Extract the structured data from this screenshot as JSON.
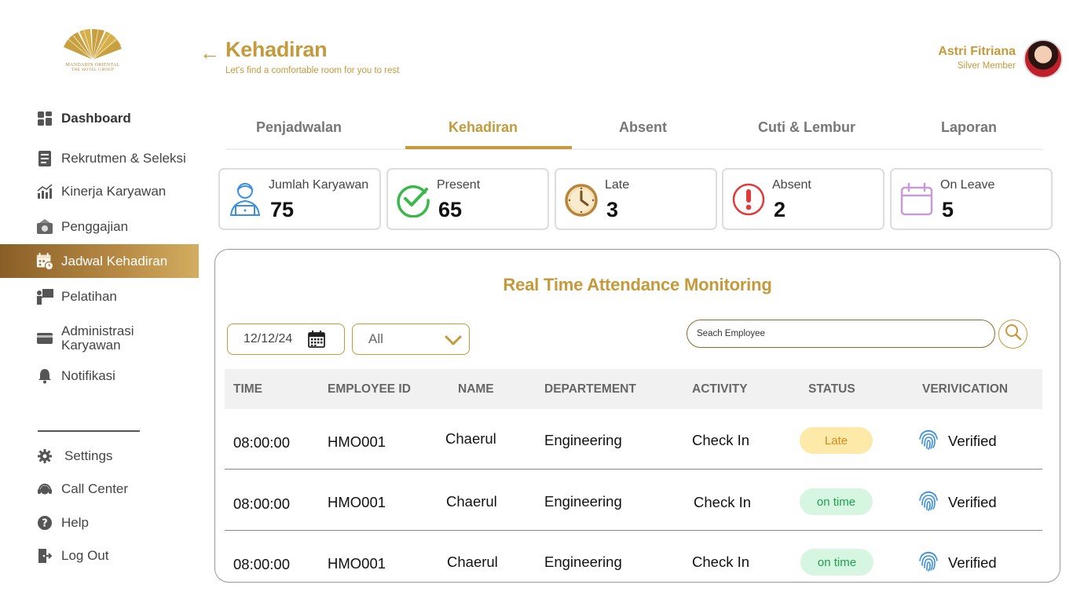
{
  "brand": {
    "line1": "MANDARIN ORIENTAL",
    "line2": "THE HOTEL GROUP"
  },
  "sidebar": {
    "items": [
      {
        "label": "Dashboard"
      },
      {
        "label": "Rekrutmen & Seleksi"
      },
      {
        "label": "Kinerja Karyawan"
      },
      {
        "label": "Penggajian"
      },
      {
        "label": "Jadwal Kehadiran"
      },
      {
        "label": "Pelatihan"
      },
      {
        "label": "Administrasi",
        "label2": "Karyawan"
      },
      {
        "label": "Notifikasi"
      }
    ],
    "bottom": [
      {
        "label": "Settings"
      },
      {
        "label": "Call Center"
      },
      {
        "label": "Help"
      },
      {
        "label": "Log Out"
      }
    ]
  },
  "header": {
    "title": "Kehadiran",
    "subtitle": "Let's find a comfortable room for you to rest",
    "back": "←"
  },
  "user": {
    "name": "Astri Fitriana",
    "tier": "Silver Member"
  },
  "tabs": [
    {
      "label": "Penjadwalan"
    },
    {
      "label": "Kehadiran"
    },
    {
      "label": "Absent"
    },
    {
      "label": "Cuti & Lembur"
    },
    {
      "label": "Laporan"
    }
  ],
  "stats": [
    {
      "label": "Jumlah Karyawan",
      "value": "75"
    },
    {
      "label": "Present",
      "value": "65"
    },
    {
      "label": "Late",
      "value": "3"
    },
    {
      "label": "Absent",
      "value": "2"
    },
    {
      "label": "On Leave",
      "value": "5"
    }
  ],
  "monitor": {
    "title": "Real Time Attendance Monitoring",
    "date": "12/12/24",
    "filter": "All",
    "search_placeholder": "Seach Employee",
    "columns": [
      "TIME",
      "EMPLOYEE ID",
      "NAME",
      "DEPARTEMENT",
      "ACTIVITY",
      "STATUS",
      "VERIVICATION"
    ],
    "rows": [
      {
        "time": "08:00:00",
        "id": "HMO001",
        "name": "Chaerul",
        "dept": "Engineering",
        "activity": "Check In",
        "status": "Late",
        "verification": "Verified"
      },
      {
        "time": "08:00:00",
        "id": "HMO001",
        "name": "Chaerul",
        "dept": "Engineering",
        "activity": "Check In",
        "status": "on time",
        "verification": "Verified"
      },
      {
        "time": "08:00:00",
        "id": "HMO001",
        "name": "Chaerul",
        "dept": "Engineering",
        "activity": "Check In",
        "status": "on time",
        "verification": "Verified"
      }
    ]
  },
  "colors": {
    "accent": "#c49a3c",
    "late_bg": "#fde9a8",
    "ontime_bg": "#d7f6e1"
  }
}
